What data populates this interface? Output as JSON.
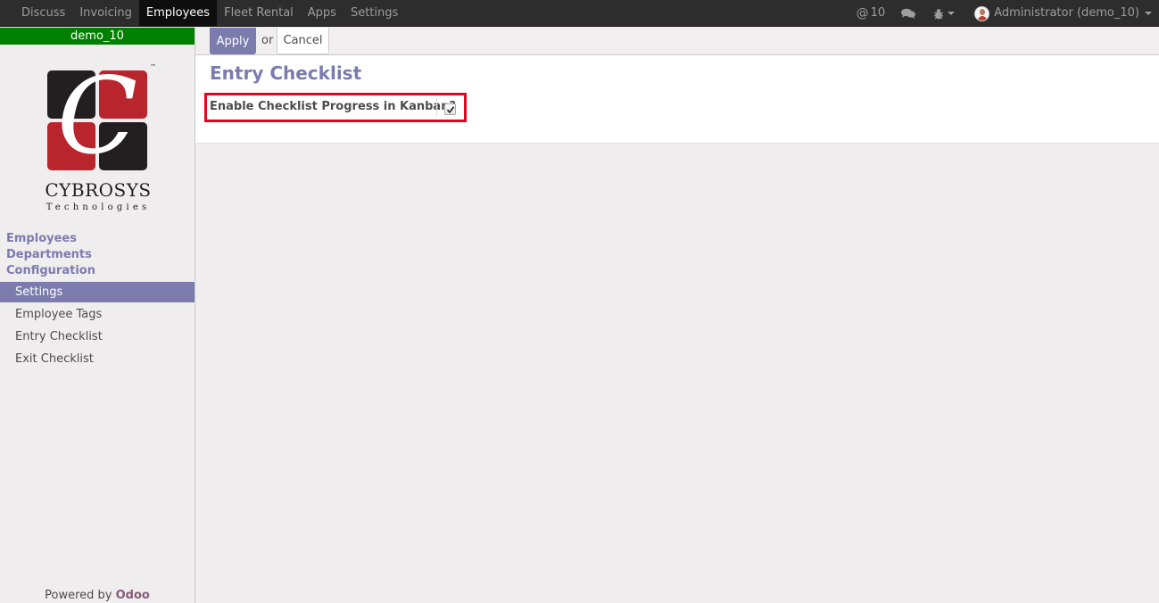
{
  "topbar": {
    "menu": [
      {
        "label": "Discuss",
        "active": false
      },
      {
        "label": "Invoicing",
        "active": false
      },
      {
        "label": "Employees",
        "active": true
      },
      {
        "label": "Fleet Rental",
        "active": false
      },
      {
        "label": "Apps",
        "active": false
      },
      {
        "label": "Settings",
        "active": false
      }
    ],
    "mentions_symbol": "@",
    "mentions_count": "10",
    "user_label": "Administrator (demo_10)"
  },
  "sidebar": {
    "db_name": "demo_10",
    "logo": {
      "brand": "CYBROSYS",
      "subtitle": "Technologies",
      "letter": "C",
      "tm": "™",
      "colors": {
        "red": "#b9252d",
        "dark": "#231f20"
      }
    },
    "sections": [
      "Employees",
      "Departments",
      "Configuration"
    ],
    "items": [
      {
        "label": "Settings",
        "active": true
      },
      {
        "label": "Employee Tags",
        "active": false
      },
      {
        "label": "Entry Checklist",
        "active": false
      },
      {
        "label": "Exit Checklist",
        "active": false
      }
    ],
    "powered_prefix": "Powered by",
    "powered_brand": "Odoo"
  },
  "control_panel": {
    "apply_label": "Apply",
    "or_label": "or",
    "cancel_label": "Cancel"
  },
  "form": {
    "title": "Entry Checklist",
    "field_label": "Enable Checklist Progress in Kanban?",
    "checked": true
  },
  "colors": {
    "primary": "#7c7bad",
    "db_bar": "#008000",
    "highlight": "#e3051b",
    "navbar": "#2d2d2d",
    "odoo": "#875a7b"
  }
}
